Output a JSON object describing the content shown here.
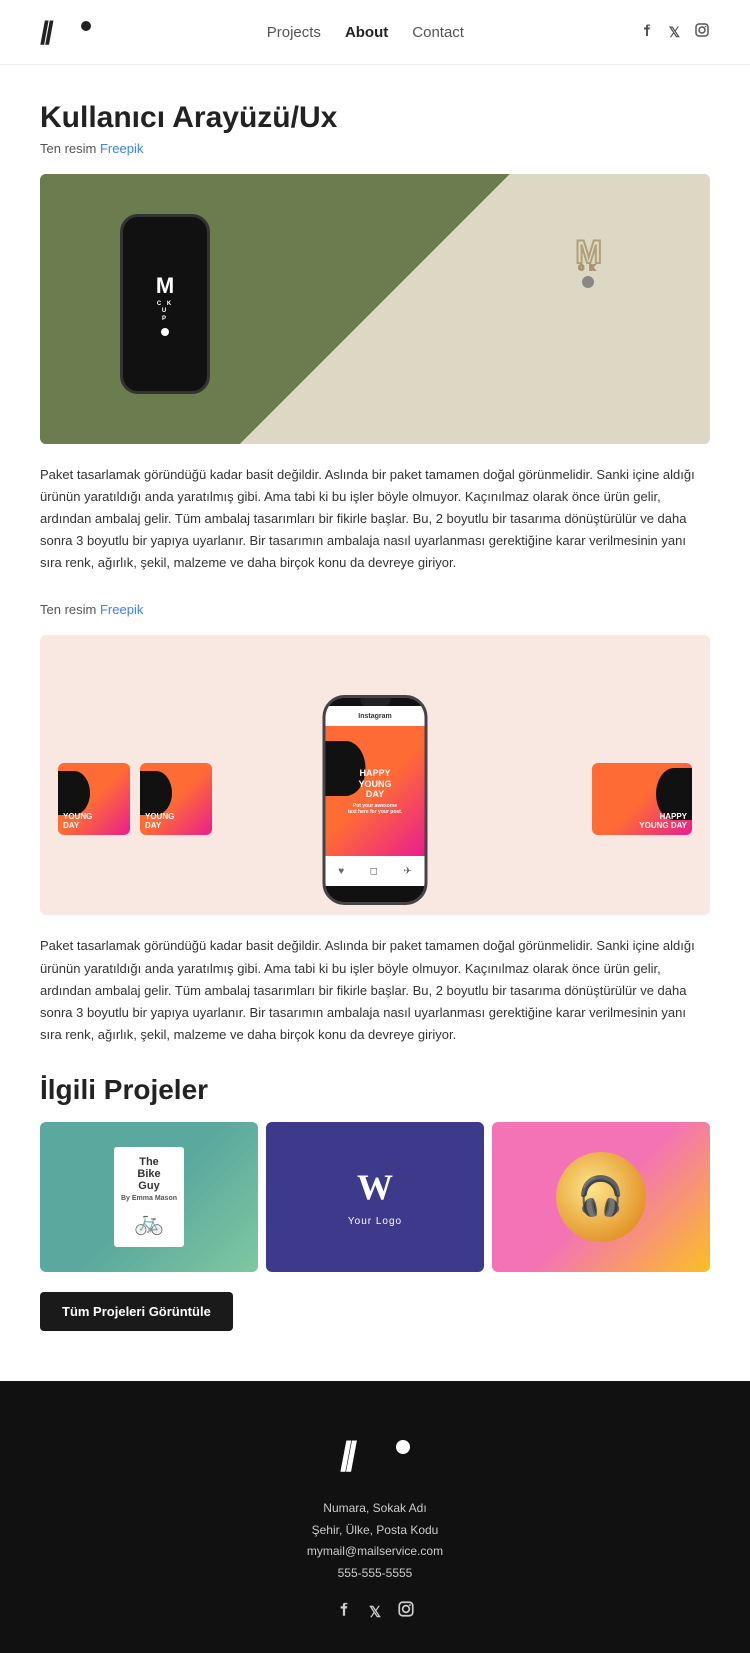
{
  "navbar": {
    "logo_text": "//•",
    "links": [
      {
        "label": "Projects",
        "active": false
      },
      {
        "label": "About",
        "active": true
      },
      {
        "label": "Contact",
        "active": false
      }
    ],
    "social": [
      {
        "name": "facebook",
        "icon": "f"
      },
      {
        "name": "twitter-x",
        "icon": "𝕏"
      },
      {
        "name": "instagram",
        "icon": "◻"
      }
    ]
  },
  "page": {
    "title": "Kullanıcı Arayüzü/Ux",
    "source_prefix": "Ten resim",
    "source_link_label": "Freepik",
    "source_link_2_label": "Freepik",
    "description_1": "Paket tasarlamak göründüğü kadar basit değildir. Aslında bir paket tamamen doğal görünmelidir. Sanki içine aldığı ürünün yaratıldığı anda yaratılmış gibi. Ama tabi ki bu işler böyle olmuyor. Kaçınılmaz olarak önce ürün gelir, ardından ambalaj gelir. Tüm ambalaj tasarımları bir fikirle başlar. Bu, 2 boyutlu bir tasarıma dönüştürülür ve daha sonra 3 boyutlu bir yapıya uyarlanır. Bir tasarımın ambalaja nasıl uyarlanması gerektiğine karar verilmesinin yanı sıra renk, ağırlık, şekil, malzeme ve daha birçok konu da devreye giriyor.",
    "description_2": "Paket tasarlamak göründüğü kadar basit değildir. Aslında bir paket tamamen doğal görünmelidir. Sanki içine aldığı ürünün yaratıldığı anda yaratılmış gibi. Ama tabi ki bu işler böyle olmuyor. Kaçınılmaz olarak önce ürün gelir, ardından ambalaj gelir. Tüm ambalaj tasarımları bir fikirle başlar. Bu, 2 boyutlu bir tasarıma dönüştürülür ve daha sonra 3 boyutlu bir yapıya uyarlanır. Bir tasarımın ambalaja nasıl uyarlanması gerektiğine karar verilmesinin yanı sıra renk, ağırlık, şekil, malzeme ve daha birçok konu da devreye giriyor.",
    "related_title": "İlgili Projeler",
    "cta_button": "Tüm Projeleri Görüntüle",
    "project_cards": [
      {
        "label": "The Bike Guy",
        "subtitle": "By Emma Mason"
      },
      {
        "label": "Your Logo",
        "icon": "W"
      },
      {
        "label": "Headphones",
        "icon": "🎧"
      }
    ]
  },
  "footer": {
    "address_line1": "Numara, Sokak Adı",
    "address_line2": "Şehir, Ülke, Posta Kodu",
    "email": "mymail@mailservice.com",
    "phone": "555-555-5555",
    "social": [
      {
        "name": "facebook",
        "icon": "f"
      },
      {
        "name": "twitter-x",
        "icon": "𝕏"
      },
      {
        "name": "instagram",
        "icon": "◻"
      }
    ]
  },
  "insta_cards": {
    "card1_line1": "YOUNG",
    "card1_line2": "DAY",
    "card2_line1": "YOUNG",
    "card2_line2": "DAY",
    "card3_line1": "HAPPY",
    "card3_line2": "YOUNG DAY",
    "card4_line1": "HAPPY",
    "card4_line2": "YOUNG DAY"
  }
}
